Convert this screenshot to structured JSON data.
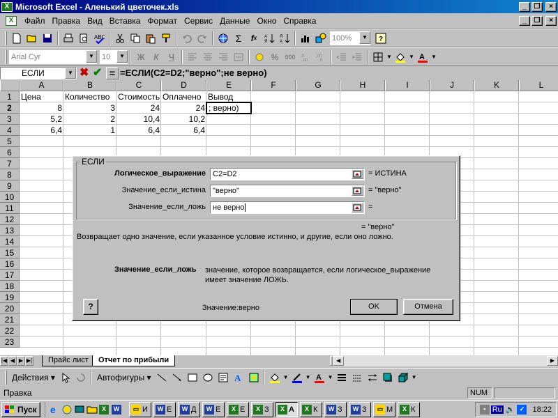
{
  "window": {
    "title": "Microsoft Excel - Аленький цветочек.xls"
  },
  "menu": [
    "Файл",
    "Правка",
    "Вид",
    "Вставка",
    "Формат",
    "Сервис",
    "Данные",
    "Окно",
    "Справка"
  ],
  "toolbar": {
    "zoom": "100%",
    "font": "Arial Cyr",
    "size": "10",
    "bold": "Ж",
    "italic": "К",
    "underline": "Ч",
    "percent": "%",
    "thousands": "000",
    "sigma": "Σ",
    "fx": "f",
    "fx_sub": "x"
  },
  "formula_bar": {
    "name_box": "ЕСЛИ",
    "eq": "=",
    "formula": "=ЕСЛИ(C2=D2;\"верно\";не верно)"
  },
  "sheet": {
    "columns": [
      "A",
      "B",
      "C",
      "D",
      "E",
      "F",
      "G",
      "H",
      "I",
      "J",
      "K",
      "L"
    ],
    "rows": [
      "1",
      "2",
      "3",
      "4",
      "5",
      "6",
      "7",
      "8",
      "9",
      "10",
      "11",
      "12",
      "13",
      "14",
      "15",
      "16",
      "17",
      "18",
      "19",
      "20",
      "21",
      "22",
      "23"
    ],
    "headers": [
      "Цена",
      "Количество",
      "Стоимость",
      "Оплачено",
      "Вывод"
    ],
    "data": [
      [
        "8",
        "3",
        "24",
        "24"
      ],
      [
        "5,2",
        "2",
        "10,4",
        "10,2"
      ],
      [
        "6,4",
        "1",
        "6,4",
        "6,4"
      ]
    ],
    "active_cell_text": "; верно)"
  },
  "dialog": {
    "title": "ЕСЛИ",
    "args": [
      {
        "label": "Логическое_выражение",
        "value": "C2=D2",
        "result": "= ИСТИНА"
      },
      {
        "label": "Значение_если_истина",
        "value": "\"верно\"",
        "result": "= \"верно\""
      },
      {
        "label": "Значение_если_ложь",
        "value": "не верно",
        "result": "="
      }
    ],
    "overall_result": "= \"верно\"",
    "description": "Возвращает одно значение, если указанное условие истинно, и другие, если оно ложно.",
    "arg_help_name": "Значение_если_ложь",
    "arg_help_text": "значение, которое возвращается, если логическое_выражение имеет значение ЛОЖЬ.",
    "value_label": "Значение:",
    "value": "верно",
    "ok": "OK",
    "cancel": "Отмена",
    "help": "?"
  },
  "tabs": [
    "Прайс лист",
    "Отчет по прибыли"
  ],
  "drawing": {
    "actions": "Действия",
    "autoshapes": "Автофигуры"
  },
  "status": {
    "text": "Правка",
    "num": "NUM"
  },
  "taskbar": {
    "start": "Пуск",
    "buttons": [
      "И",
      "Е",
      "Д",
      "Е",
      "Е",
      "З",
      "А",
      "К",
      "З",
      "З",
      "М",
      "К"
    ],
    "lang": "Ru",
    "clock": "18:22"
  },
  "colors": {
    "title_from": "#000080",
    "title_to": "#1084d0",
    "fill_highlight": "#ffff00",
    "font_red": "#ff0000"
  }
}
